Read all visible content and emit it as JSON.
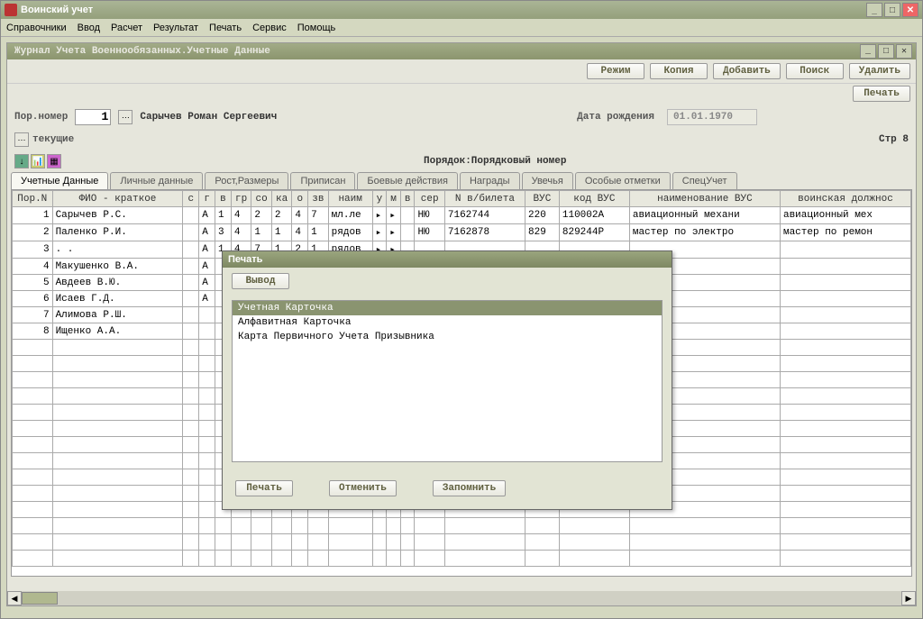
{
  "app": {
    "title": "Воинский учет"
  },
  "menu": {
    "items": [
      "Справочники",
      "Ввод",
      "Расчет",
      "Результат",
      "Печать",
      "Сервис",
      "Помощь"
    ]
  },
  "subwindow": {
    "title": "Журнал Учета Военнообязанных.Учетные Данные"
  },
  "toolbar": {
    "mode": "Режим",
    "copy": "Копия",
    "add": "Добавить",
    "search": "Поиск",
    "delete": "Удалить",
    "print": "Печать"
  },
  "form": {
    "por_label": "Пор.номер",
    "por_value": "1",
    "name_value": "Сарычев Роман Сергеевич",
    "dob_label": "Дата рождения",
    "dob_value": "01.01.1970",
    "current_label": "текущие",
    "page_label": "Стр 8",
    "order_label": "Порядок:Порядковый номер"
  },
  "tabs": [
    {
      "label": "Учетные Данные",
      "active": true
    },
    {
      "label": "Личные данные",
      "active": false
    },
    {
      "label": "Рост,Размеры",
      "active": false
    },
    {
      "label": "Приписан",
      "active": false
    },
    {
      "label": "Боевые действия",
      "active": false
    },
    {
      "label": "Награды",
      "active": false
    },
    {
      "label": "Увечья",
      "active": false
    },
    {
      "label": "Особые отметки",
      "active": false
    },
    {
      "label": "СпецУчет",
      "active": false
    }
  ],
  "table": {
    "headers": [
      "Пор.N",
      "ФИО - краткое",
      "с",
      "г",
      "в",
      "гр",
      "со",
      "ка",
      "о",
      "зв",
      "наим",
      "у",
      "м",
      "в",
      "сер",
      "N в/билета",
      "ВУС",
      "код ВУС",
      "наименование ВУС",
      "воинская должнос"
    ],
    "rows": [
      {
        "n": "1",
        "fio": "Сарычев Р.С.",
        "s": "",
        "g": "А",
        "v": "1",
        "gr": "4",
        "so": "2",
        "ka": "2",
        "o": "4",
        "zv": "7",
        "naim": "мл.ле",
        "u": "▸",
        "m": "▸",
        "v2": "",
        "ser": "НЮ",
        "bilet": "7162744",
        "vus": "220",
        "kodvus": "110002А",
        "namevus": "авиационный механи",
        "dolz": "авиационный мех"
      },
      {
        "n": "2",
        "fio": "Паленко Р.И.",
        "s": "",
        "g": "А",
        "v": "3",
        "gr": "4",
        "so": "1",
        "ka": "1",
        "o": "4",
        "zv": "1",
        "naim": "рядов",
        "u": "▸",
        "m": "▸",
        "v2": "",
        "ser": "НЮ",
        "bilet": "7162878",
        "vus": "829",
        "kodvus": "829244Р",
        "namevus": "мастер по электро",
        "dolz": "мастер по ремон"
      },
      {
        "n": "3",
        "fio": ". .",
        "s": "",
        "g": "А",
        "v": "1",
        "gr": "4",
        "so": "7",
        "ka": "1",
        "o": "2",
        "zv": "1",
        "naim": "рядов",
        "u": "▸",
        "m": "▸",
        "v2": "",
        "ser": "",
        "bilet": "",
        "vus": "",
        "kodvus": "",
        "namevus": "",
        "dolz": ""
      },
      {
        "n": "4",
        "fio": "Макушенко В.А.",
        "s": "",
        "g": "А",
        "v": "",
        "gr": "",
        "so": "",
        "ka": "",
        "o": "",
        "zv": "",
        "naim": "",
        "u": "",
        "m": "",
        "v2": "",
        "ser": "",
        "bilet": "",
        "vus": "",
        "kodvus": "",
        "namevus": "",
        "dolz": ""
      },
      {
        "n": "5",
        "fio": "Авдеев В.Ю.",
        "s": "",
        "g": "А",
        "v": "",
        "gr": "",
        "so": "",
        "ka": "",
        "o": "",
        "zv": "",
        "naim": "",
        "u": "",
        "m": "",
        "v2": "",
        "ser": "",
        "bilet": "",
        "vus": "",
        "kodvus": "",
        "namevus": "",
        "dolz": ""
      },
      {
        "n": "6",
        "fio": "Исаев Г.Д.",
        "s": "",
        "g": "А",
        "v": "",
        "gr": "",
        "so": "",
        "ka": "",
        "o": "",
        "zv": "",
        "naim": "",
        "u": "",
        "m": "",
        "v2": "",
        "ser": "",
        "bilet": "",
        "vus": "",
        "kodvus": "",
        "namevus": "",
        "dolz": ""
      },
      {
        "n": "7",
        "fio": "Алимова Р.Ш.",
        "s": "",
        "g": "",
        "v": "",
        "gr": "",
        "so": "",
        "ka": "",
        "o": "",
        "zv": "",
        "naim": "",
        "u": "",
        "m": "",
        "v2": "",
        "ser": "",
        "bilet": "",
        "vus": "",
        "kodvus": "",
        "namevus": "",
        "dolz": ""
      },
      {
        "n": "8",
        "fio": "Ищенко А.А.",
        "s": "",
        "g": "",
        "v": "",
        "gr": "",
        "so": "",
        "ka": "",
        "o": "",
        "zv": "",
        "naim": "",
        "u": "",
        "m": "",
        "v2": "",
        "ser": "",
        "bilet": "",
        "vus": "",
        "kodvus": "",
        "namevus": "",
        "dolz": ""
      }
    ]
  },
  "modal": {
    "title": "Печать",
    "output_btn": "Вывод",
    "items": [
      "Учетная Карточка",
      "Алфавитная Карточка",
      "Карта Первичного Учета Призывника"
    ],
    "selected_index": 0,
    "print_btn": "Печать",
    "cancel_btn": "Отменить",
    "remember_btn": "Запомнить"
  }
}
